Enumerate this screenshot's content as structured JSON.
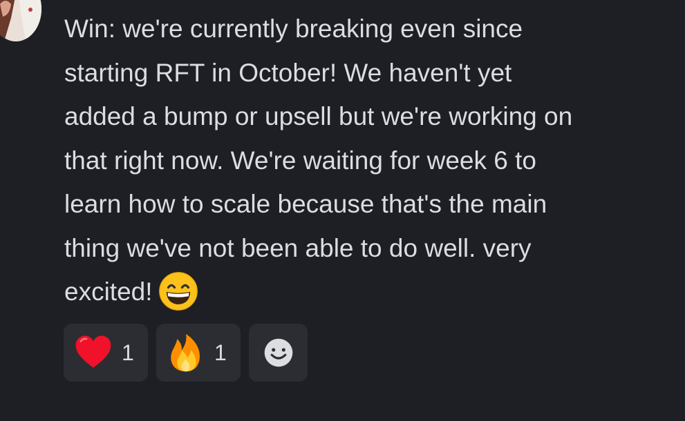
{
  "message": {
    "lines": [
      "Win: we're currently breaking even since",
      "starting RFT in October! We haven't yet",
      "added a bump or upsell but we're working on",
      "that right now. We're waiting for week 6 to",
      "learn how to scale because that's the main",
      "thing we've not been able to do well. very",
      "excited!"
    ],
    "trailing_emoji": "grinning-face-with-smiling-eyes-emoji"
  },
  "reactions": [
    {
      "emoji": "red-heart-emoji",
      "count": "1"
    },
    {
      "emoji": "fire-emoji",
      "count": "1"
    }
  ],
  "add_reaction": {
    "icon": "smiley-add-reaction-icon"
  },
  "colors": {
    "background": "#1e1f24",
    "text": "#dcdde1",
    "reaction_bg": "#2b2d33"
  }
}
